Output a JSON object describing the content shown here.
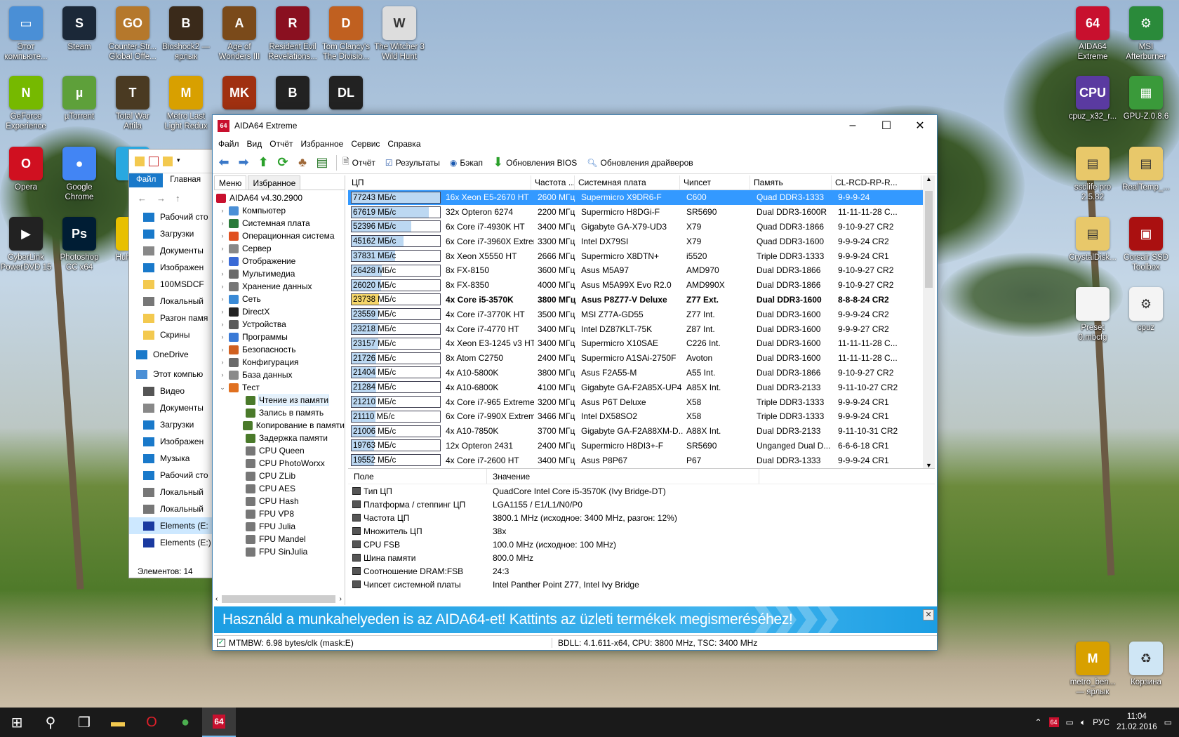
{
  "desktop_left": [
    {
      "label": "Этот компьюте...",
      "color": "#4a8fd6",
      "glyph": "▭"
    },
    {
      "label": "Steam",
      "color": "#1b2838",
      "glyph": "S"
    },
    {
      "label": "Counter-Str... Global Offe...",
      "color": "#b5782c",
      "glyph": "GO"
    },
    {
      "label": "Bioshock2 — ярлык",
      "color": "#3a2a1a",
      "glyph": "B"
    },
    {
      "label": "Age of Wonders III",
      "color": "#7a4a1a",
      "glyph": "A"
    },
    {
      "label": "Resident Evil Revelations...",
      "color": "#8a1020",
      "glyph": "R"
    },
    {
      "label": "Tom Clancy's The Divisio...",
      "color": "#c06020",
      "glyph": "D"
    },
    {
      "label": "The Witcher 3 Wild Hunt",
      "color": "#ddd",
      "glyph": "W"
    },
    {
      "label": "GeForce Experience",
      "color": "#76b900",
      "glyph": "N"
    },
    {
      "label": "µTorrent",
      "color": "#5ea03a",
      "glyph": "µ"
    },
    {
      "label": "Total War Attila",
      "color": "#4a3a22",
      "glyph": "T"
    },
    {
      "label": "Metro Last Light Redux",
      "color": "#d8a000",
      "glyph": "M"
    },
    {
      "label": "",
      "color": "#a03010",
      "glyph": "MK"
    },
    {
      "label": "",
      "color": "#222",
      "glyph": "B"
    },
    {
      "label": "",
      "color": "#222",
      "glyph": "DL"
    },
    {
      "label": "Opera",
      "color": "#d01020",
      "glyph": "O"
    },
    {
      "label": "Google Chrome",
      "color": "#4285f4",
      "glyph": "●"
    },
    {
      "label": "S",
      "color": "#29a8e0",
      "glyph": "S"
    },
    {
      "label": "CyberLink PowerDVD 15",
      "color": "#222",
      "glyph": "▶"
    },
    {
      "label": "Photoshop CC x64",
      "color": "#001d34",
      "glyph": "Ps"
    },
    {
      "label": "Huh — ...",
      "color": "#e8c000",
      "glyph": "H"
    }
  ],
  "desktop_right": [
    {
      "label": "AIDA64 Extreme",
      "color": "#c8102e",
      "glyph": "64"
    },
    {
      "label": "MSI Afterburner",
      "color": "#2a8a3a",
      "glyph": "⚙"
    },
    {
      "label": "cpuz_x32_r...",
      "color": "#5a3aa0",
      "glyph": "CPU"
    },
    {
      "label": "GPU-Z.0.8.6",
      "color": "#3a9a3a",
      "glyph": "▦"
    },
    {
      "label": "ssdlife pro 2.5.82",
      "color": "#e8c86a",
      "glyph": "▤"
    },
    {
      "label": "RealTemp_...",
      "color": "#e8c86a",
      "glyph": "▤"
    },
    {
      "label": "CrystalDisk...",
      "color": "#e8c86a",
      "glyph": "▤"
    },
    {
      "label": "Corsair SSD Toolbox",
      "color": "#aa1010",
      "glyph": "▣"
    },
    {
      "label": "Preset 0.mbcfg",
      "color": "#f4f4f4",
      "glyph": " "
    },
    {
      "label": "cpuz",
      "color": "#f4f4f4",
      "glyph": "⚙"
    },
    {
      "label": "metro_ben... — ярлык",
      "color": "#d8a000",
      "glyph": "M"
    },
    {
      "label": "Корзина",
      "color": "#cfe6f5",
      "glyph": "♻"
    }
  ],
  "explorer": {
    "ribbon": [
      "Файл",
      "Главная"
    ],
    "nav_items": [
      "Рабочий сто",
      "Загрузки",
      "Документы",
      "Изображен",
      "100MSDCF",
      "Локальный",
      "Разгон памя",
      "Скрины",
      "OneDrive",
      "Этот компью",
      "Видео",
      "Документы",
      "Загрузки",
      "Изображен",
      "Музыка",
      "Рабочий сто",
      "Локальный",
      "Локальный",
      "Elements (E:",
      "Elements (E:)"
    ],
    "status": "Элементов: 14"
  },
  "window": {
    "title": "AIDA64 Extreme",
    "menu": [
      "Файл",
      "Вид",
      "Отчёт",
      "Избранное",
      "Сервис",
      "Справка"
    ],
    "toolbar": {
      "report": "Отчёт",
      "results": "Результаты",
      "backup": "Бэкап",
      "bios": "Обновления BIOS",
      "drivers": "Обновления драйверов"
    },
    "tabs": [
      "Меню",
      "Избранное"
    ],
    "tree": [
      {
        "label": "AIDA64 v4.30.2900",
        "level": 0,
        "arrow": "",
        "color": "#c8102e"
      },
      {
        "label": "Компьютер",
        "level": 1,
        "arrow": "›",
        "color": "#4a8fd6"
      },
      {
        "label": "Системная плата",
        "level": 1,
        "arrow": "›",
        "color": "#2a7a3a"
      },
      {
        "label": "Операционная система",
        "level": 1,
        "arrow": "›",
        "color": "#e05020"
      },
      {
        "label": "Сервер",
        "level": 1,
        "arrow": "›",
        "color": "#888"
      },
      {
        "label": "Отображение",
        "level": 1,
        "arrow": "›",
        "color": "#3a6ad6"
      },
      {
        "label": "Мультимедиа",
        "level": 1,
        "arrow": "›",
        "color": "#6a6a6a"
      },
      {
        "label": "Хранение данных",
        "level": 1,
        "arrow": "›",
        "color": "#777"
      },
      {
        "label": "Сеть",
        "level": 1,
        "arrow": "›",
        "color": "#3a8ad6"
      },
      {
        "label": "DirectX",
        "level": 1,
        "arrow": "›",
        "color": "#222"
      },
      {
        "label": "Устройства",
        "level": 1,
        "arrow": "›",
        "color": "#5a5a5a"
      },
      {
        "label": "Программы",
        "level": 1,
        "arrow": "›",
        "color": "#3a7ad6"
      },
      {
        "label": "Безопасность",
        "level": 1,
        "arrow": "›",
        "color": "#d06020"
      },
      {
        "label": "Конфигурация",
        "level": 1,
        "arrow": "›",
        "color": "#6a6a6a"
      },
      {
        "label": "База данных",
        "level": 1,
        "arrow": "›",
        "color": "#8a8a8a"
      },
      {
        "label": "Тест",
        "level": 1,
        "arrow": "⌄",
        "color": "#e07020"
      },
      {
        "label": "Чтение из памяти",
        "level": 2,
        "arrow": "",
        "color": "#4a7a2a",
        "selected": true
      },
      {
        "label": "Запись в память",
        "level": 2,
        "arrow": "",
        "color": "#4a7a2a"
      },
      {
        "label": "Копирование в памяти",
        "level": 2,
        "arrow": "",
        "color": "#4a7a2a"
      },
      {
        "label": "Задержка памяти",
        "level": 2,
        "arrow": "",
        "color": "#4a7a2a"
      },
      {
        "label": "CPU Queen",
        "level": 2,
        "arrow": "",
        "color": "#777"
      },
      {
        "label": "CPU PhotoWorxx",
        "level": 2,
        "arrow": "",
        "color": "#777"
      },
      {
        "label": "CPU ZLib",
        "level": 2,
        "arrow": "",
        "color": "#777"
      },
      {
        "label": "CPU AES",
        "level": 2,
        "arrow": "",
        "color": "#777"
      },
      {
        "label": "CPU Hash",
        "level": 2,
        "arrow": "",
        "color": "#777"
      },
      {
        "label": "FPU VP8",
        "level": 2,
        "arrow": "",
        "color": "#777"
      },
      {
        "label": "FPU Julia",
        "level": 2,
        "arrow": "",
        "color": "#777"
      },
      {
        "label": "FPU Mandel",
        "level": 2,
        "arrow": "",
        "color": "#777"
      },
      {
        "label": "FPU SinJulia",
        "level": 2,
        "arrow": "",
        "color": "#777"
      }
    ],
    "columns": [
      "ЦП",
      "Частота ...",
      "Системная плата",
      "Чипсет",
      "Память",
      "CL-RCD-RP-R..."
    ],
    "results": [
      {
        "score": "77243 МБ/с",
        "value": 77243,
        "cpu": "16x Xeon E5-2670 HT",
        "freq": "2600 МГц",
        "board": "Supermicro X9DR6-F",
        "chipset": "C600",
        "memory": "Quad DDR3-1333",
        "timing": "9-9-9-24",
        "selected": true
      },
      {
        "score": "67619 МБ/с",
        "value": 67619,
        "cpu": "32x Opteron 6274",
        "freq": "2200 МГц",
        "board": "Supermicro H8DGi-F",
        "chipset": "SR5690",
        "memory": "Dual DDR3-1600R",
        "timing": "11-11-11-28 C..."
      },
      {
        "score": "52396 МБ/с",
        "value": 52396,
        "cpu": "6x Core i7-4930K HT",
        "freq": "3400 МГц",
        "board": "Gigabyte GA-X79-UD3",
        "chipset": "X79",
        "memory": "Quad DDR3-1866",
        "timing": "9-10-9-27 CR2"
      },
      {
        "score": "45162 МБ/с",
        "value": 45162,
        "cpu": "6x Core i7-3960X Extrem...",
        "freq": "3300 МГц",
        "board": "Intel DX79SI",
        "chipset": "X79",
        "memory": "Quad DDR3-1600",
        "timing": "9-9-9-24 CR2"
      },
      {
        "score": "37831 МБ/с",
        "value": 37831,
        "cpu": "8x Xeon X5550 HT",
        "freq": "2666 МГц",
        "board": "Supermicro X8DTN+",
        "chipset": "i5520",
        "memory": "Triple DDR3-1333",
        "timing": "9-9-9-24 CR1"
      },
      {
        "score": "26428 МБ/с",
        "value": 26428,
        "cpu": "8x FX-8150",
        "freq": "3600 МГц",
        "board": "Asus M5A97",
        "chipset": "AMD970",
        "memory": "Dual DDR3-1866",
        "timing": "9-10-9-27 CR2"
      },
      {
        "score": "26020 МБ/с",
        "value": 26020,
        "cpu": "8x FX-8350",
        "freq": "4000 МГц",
        "board": "Asus M5A99X Evo R2.0",
        "chipset": "AMD990X",
        "memory": "Dual DDR3-1866",
        "timing": "9-10-9-27 CR2"
      },
      {
        "score": "23738 МБ/с",
        "value": 23738,
        "cpu": "4x Core i5-3570K",
        "freq": "3800 МГц",
        "board": "Asus P8Z77-V Deluxe",
        "chipset": "Z77 Ext.",
        "memory": "Dual DDR3-1600",
        "timing": "8-8-8-24 CR2",
        "current": true
      },
      {
        "score": "23559 МБ/с",
        "value": 23559,
        "cpu": "4x Core i7-3770K HT",
        "freq": "3500 МГц",
        "board": "MSI Z77A-GD55",
        "chipset": "Z77 Int.",
        "memory": "Dual DDR3-1600",
        "timing": "9-9-9-24 CR2"
      },
      {
        "score": "23218 МБ/с",
        "value": 23218,
        "cpu": "4x Core i7-4770 HT",
        "freq": "3400 МГц",
        "board": "Intel DZ87KLT-75K",
        "chipset": "Z87 Int.",
        "memory": "Dual DDR3-1600",
        "timing": "9-9-9-27 CR2"
      },
      {
        "score": "23157 МБ/с",
        "value": 23157,
        "cpu": "4x Xeon E3-1245 v3 HT",
        "freq": "3400 МГц",
        "board": "Supermicro X10SAE",
        "chipset": "C226 Int.",
        "memory": "Dual DDR3-1600",
        "timing": "11-11-11-28 C..."
      },
      {
        "score": "21726 МБ/с",
        "value": 21726,
        "cpu": "8x Atom C2750",
        "freq": "2400 МГц",
        "board": "Supermicro A1SAi-2750F",
        "chipset": "Avoton",
        "memory": "Dual DDR3-1600",
        "timing": "11-11-11-28 C..."
      },
      {
        "score": "21404 МБ/с",
        "value": 21404,
        "cpu": "4x A10-5800K",
        "freq": "3800 МГц",
        "board": "Asus F2A55-M",
        "chipset": "A55 Int.",
        "memory": "Dual DDR3-1866",
        "timing": "9-10-9-27 CR2"
      },
      {
        "score": "21284 МБ/с",
        "value": 21284,
        "cpu": "4x A10-6800K",
        "freq": "4100 МГц",
        "board": "Gigabyte GA-F2A85X-UP4",
        "chipset": "A85X Int.",
        "memory": "Dual DDR3-2133",
        "timing": "9-11-10-27 CR2"
      },
      {
        "score": "21210 МБ/с",
        "value": 21210,
        "cpu": "4x Core i7-965 Extreme HT",
        "freq": "3200 МГц",
        "board": "Asus P6T Deluxe",
        "chipset": "X58",
        "memory": "Triple DDR3-1333",
        "timing": "9-9-9-24 CR1"
      },
      {
        "score": "21110 МБ/с",
        "value": 21110,
        "cpu": "6x Core i7-990X Extreme ...",
        "freq": "3466 МГц",
        "board": "Intel DX58SO2",
        "chipset": "X58",
        "memory": "Triple DDR3-1333",
        "timing": "9-9-9-24 CR1"
      },
      {
        "score": "21006 МБ/с",
        "value": 21006,
        "cpu": "4x A10-7850K",
        "freq": "3700 МГц",
        "board": "Gigabyte GA-F2A88XM-D...",
        "chipset": "A88X Int.",
        "memory": "Dual DDR3-2133",
        "timing": "9-11-10-31 CR2"
      },
      {
        "score": "19763 МБ/с",
        "value": 19763,
        "cpu": "12x Opteron 2431",
        "freq": "2400 МГц",
        "board": "Supermicro H8DI3+-F",
        "chipset": "SR5690",
        "memory": "Unganged Dual D...",
        "timing": "6-6-6-18 CR1"
      },
      {
        "score": "19552 МБ/с",
        "value": 19552,
        "cpu": "4x Core i7-2600 HT",
        "freq": "3400 МГц",
        "board": "Asus P8P67",
        "chipset": "P67",
        "memory": "Dual DDR3-1333",
        "timing": "9-9-9-24 CR1"
      }
    ],
    "detail_columns": [
      "Поле",
      "Значение"
    ],
    "details": [
      {
        "field": "Тип ЦП",
        "value": "QuadCore Intel Core i5-3570K  (Ivy Bridge-DT)"
      },
      {
        "field": "Платформа / степпинг ЦП",
        "value": "LGA1155 / E1/L1/N0/P0"
      },
      {
        "field": "Частота ЦП",
        "value": "3800.1 MHz  (исходное: 3400 MHz, разгон: 12%)"
      },
      {
        "field": "Множитель ЦП",
        "value": "38x"
      },
      {
        "field": "CPU FSB",
        "value": "100.0 MHz  (исходное: 100 MHz)"
      },
      {
        "field": "Шина памяти",
        "value": "800.0 MHz"
      },
      {
        "field": "Соотношение DRAM:FSB",
        "value": "24:3"
      },
      {
        "field": "Чипсет системной платы",
        "value": "Intel Panther Point Z77, Intel Ivy Bridge"
      }
    ],
    "banner": "Használd a munkahelyeden is az AIDA64-et! Kattints az üzleti termékek megismeréséhez!",
    "status_left": "MTMBW: 6.98 bytes/clk (mask:E)",
    "status_right": "BDLL: 4.1.611-x64, CPU: 3800 MHz, TSC: 3400 MHz"
  },
  "taskbar": {
    "lang": "РУС",
    "time": "11:04",
    "date": "21.02.2016"
  },
  "colors": {
    "accent": "#3399ff",
    "banner": "#1c9ee3",
    "highlight": "#f5d66a",
    "bar": "#bcd8f2"
  }
}
